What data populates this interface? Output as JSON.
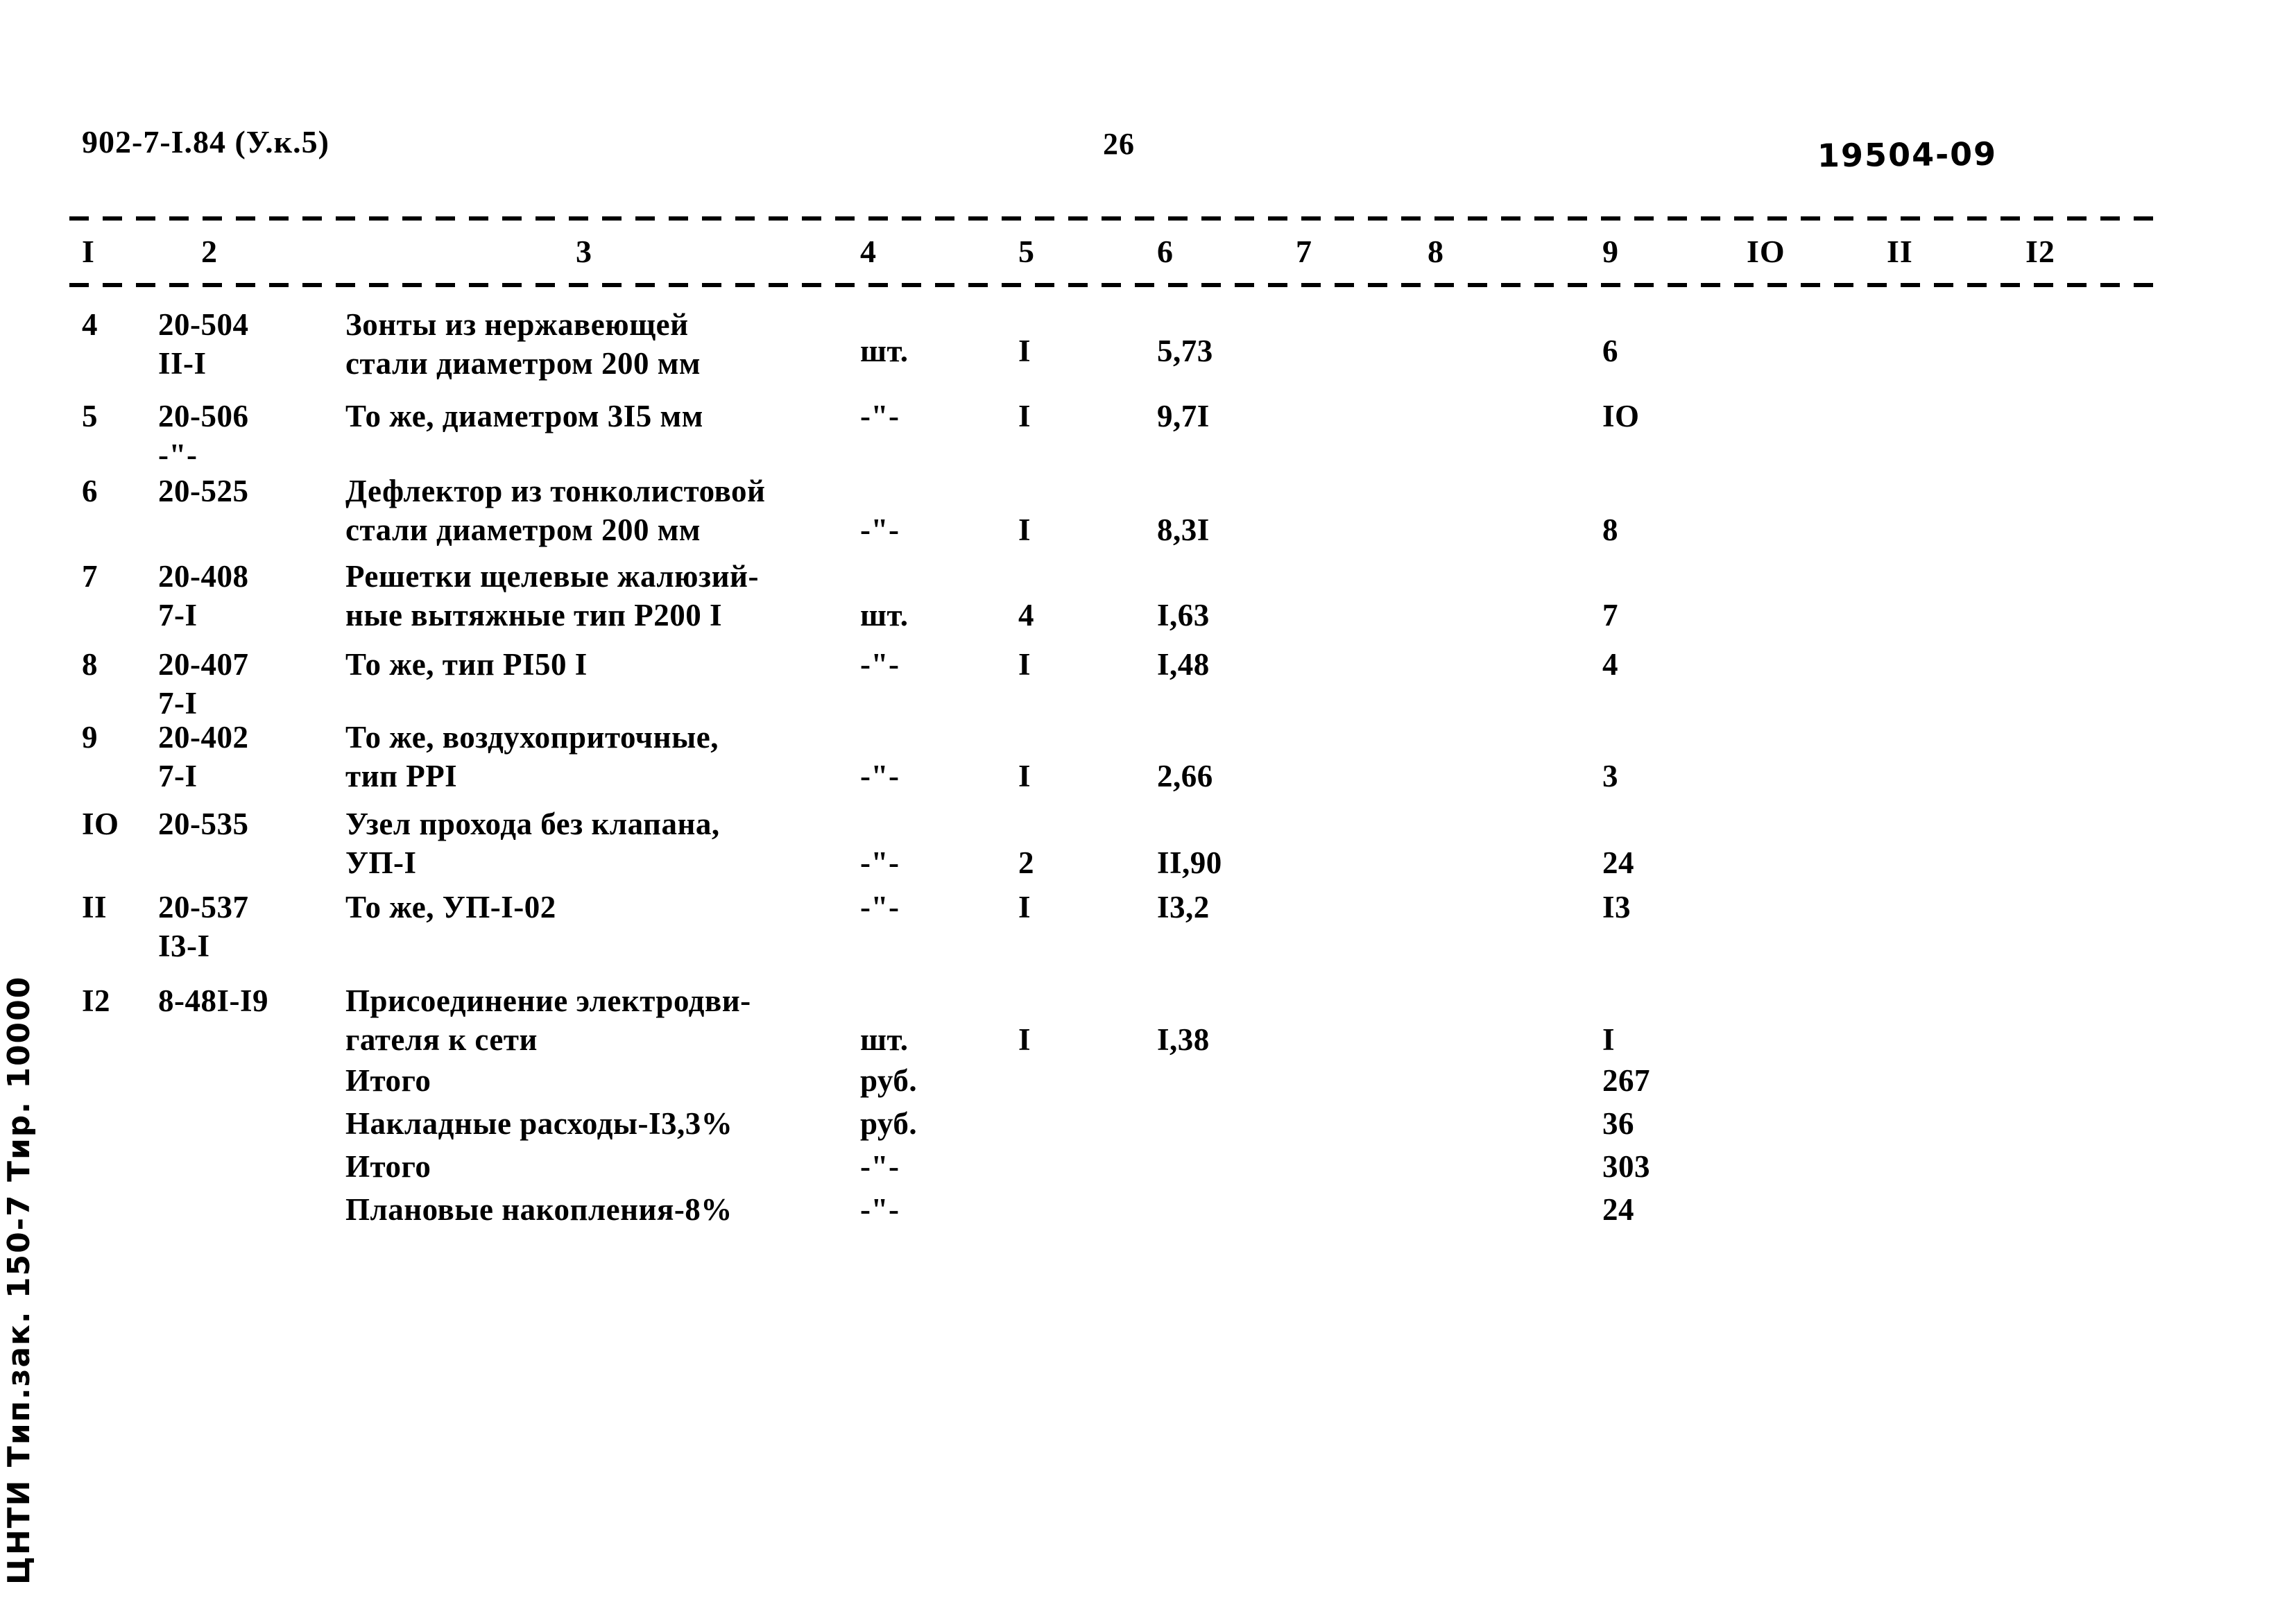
{
  "header": {
    "doc_code": "902-7-I.84 (У.к.5)",
    "page_number": "26",
    "archive_code": "19504-09"
  },
  "table": {
    "column_headers": [
      "I",
      "2",
      "3",
      "4",
      "5",
      "6",
      "7",
      "8",
      "9",
      "IO",
      "II",
      "I2"
    ],
    "rows": [
      {
        "no": "4",
        "code_line1": "20-504",
        "code_line2": "II-I",
        "name_line1": "Зонты из нержавеющей",
        "name_line2": "стали диаметром 200 мм",
        "unit": "шт.",
        "qty": "I",
        "price": "5,73",
        "col7": "",
        "col8": "",
        "total": "6"
      },
      {
        "no": "5",
        "code_line1": "20-506",
        "code_line2": "-\"-",
        "name_line1": "То же, диаметром 3I5 мм",
        "name_line2": "",
        "unit": "-\"-",
        "qty": "I",
        "price": "9,7I",
        "col7": "",
        "col8": "",
        "total": "IO"
      },
      {
        "no": "6",
        "code_line1": "20-525",
        "code_line2": "",
        "name_line1": "Дефлектор из тонколистовой",
        "name_line2": "стали диаметром 200 мм",
        "unit": "-\"-",
        "qty": "I",
        "price": "8,3I",
        "col7": "",
        "col8": "",
        "total": "8"
      },
      {
        "no": "7",
        "code_line1": "20-408",
        "code_line2": "7-I",
        "name_line1": "Решетки щелевые жалюзий-",
        "name_line2": "ные вытяжные тип Р200 I",
        "unit": "шт.",
        "qty": "4",
        "price": "I,63",
        "col7": "",
        "col8": "",
        "total": "7"
      },
      {
        "no": "8",
        "code_line1": "20-407",
        "code_line2": "7-I",
        "name_line1": "То же, тип РI50 I",
        "name_line2": "",
        "unit": "-\"-",
        "qty": "I",
        "price": "I,48",
        "col7": "",
        "col8": "",
        "total": "4"
      },
      {
        "no": "9",
        "code_line1": "20-402",
        "code_line2": "7-I",
        "name_line1": "То же, воздухоприточные,",
        "name_line2": "тип РРI",
        "unit": "-\"-",
        "qty": "I",
        "price": "2,66",
        "col7": "",
        "col8": "",
        "total": "3"
      },
      {
        "no": "IO",
        "code_line1": "20-535",
        "code_line2": "",
        "name_line1": "Узел прохода без клапана,",
        "name_line2": "УП-I",
        "unit": "-\"-",
        "qty": "2",
        "price": "II,90",
        "col7": "",
        "col8": "",
        "total": "24"
      },
      {
        "no": "II",
        "code_line1": "20-537",
        "code_line2": "I3-I",
        "name_line1": "То же, УП-I-02",
        "name_line2": "",
        "unit": "-\"-",
        "qty": "I",
        "price": "I3,2",
        "col7": "",
        "col8": "",
        "total": "I3"
      },
      {
        "no": "I2",
        "code_line1": "8-48I-I9",
        "code_line2": "",
        "name_line1": "Присоединение электродви-",
        "name_line2": "гателя к сети",
        "unit": "шт.",
        "qty": "I",
        "price": "I,38",
        "col7": "",
        "col8": "",
        "total": "I"
      }
    ],
    "summary_rows": [
      {
        "no": "",
        "code_line1": "",
        "code_line2": "",
        "name_line1": "Итого",
        "name_line2": "",
        "unit": "руб.",
        "qty": "",
        "price": "",
        "col7": "",
        "col8": "",
        "total": "267"
      },
      {
        "no": "",
        "code_line1": "",
        "code_line2": "",
        "name_line1": "Накладные расходы-I3,3%",
        "name_line2": "",
        "unit": "руб.",
        "qty": "",
        "price": "",
        "col7": "",
        "col8": "",
        "total": "36"
      },
      {
        "no": "",
        "code_line1": "",
        "code_line2": "",
        "name_line1": "Итого",
        "name_line2": "",
        "unit": "-\"-",
        "qty": "",
        "price": "",
        "col7": "",
        "col8": "",
        "total": "303"
      },
      {
        "no": "",
        "code_line1": "",
        "code_line2": "",
        "name_line1": "Плановые накопления-8%",
        "name_line2": "",
        "unit": "-\"-",
        "qty": "",
        "price": "",
        "col7": "",
        "col8": "",
        "total": "24"
      }
    ]
  },
  "footer": {
    "imprint": "ЦНТИ Тип.зак. 150-7 Тир. 10000"
  }
}
